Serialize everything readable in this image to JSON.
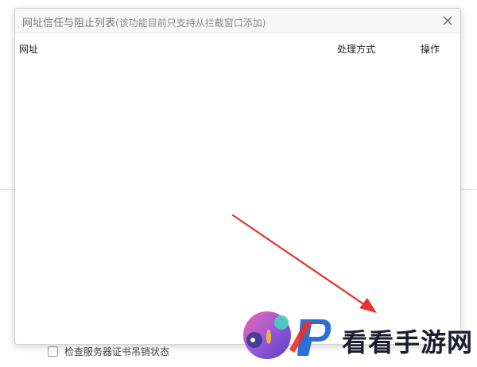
{
  "dialog": {
    "title": "网址信任与阻止列表",
    "subtitle": "(该功能目前只支持从拦截窗口添加)",
    "columns": {
      "url": "网址",
      "method": "处理方式",
      "action": "操作"
    },
    "rows": []
  },
  "background": {
    "checkbox_label": "检查服务器证书吊销状态",
    "checkbox_checked": false
  },
  "watermark": {
    "text": "看看手游网"
  },
  "colors": {
    "arrow": "#e8322b",
    "title_text": "#7a7a7a"
  },
  "icons": {
    "close": "close-icon",
    "watermark_logo": "watermark-logo-icon"
  }
}
